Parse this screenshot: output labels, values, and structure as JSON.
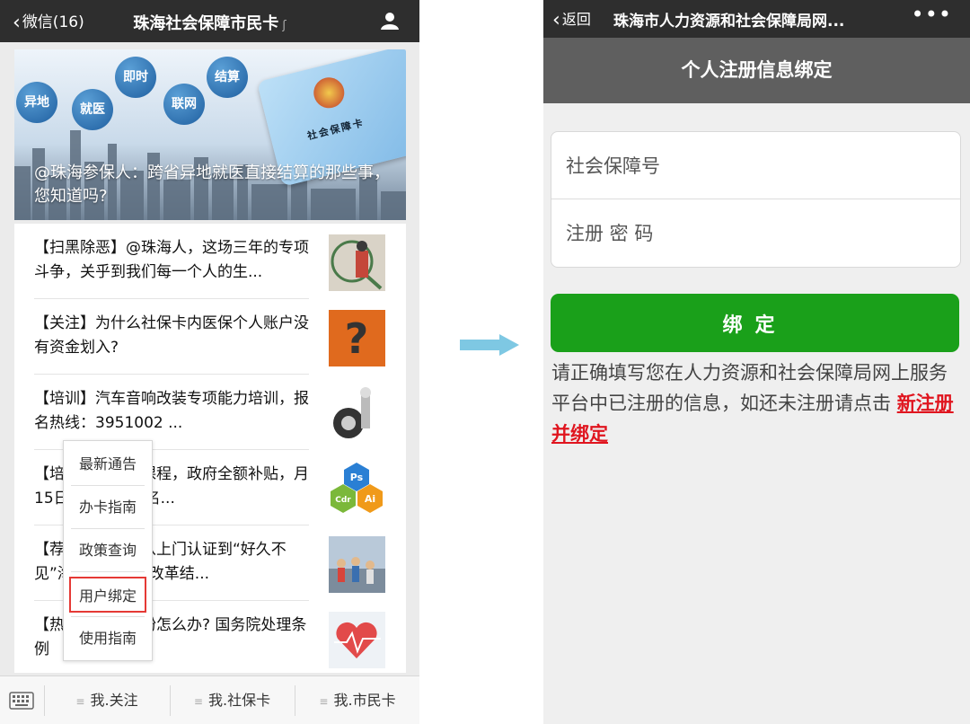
{
  "left": {
    "nav": {
      "back_label": "微信(16)",
      "title": "珠海社会保障市民卡"
    },
    "hero": {
      "bubbles": [
        "异地",
        "就医",
        "即时",
        "联网",
        "结算"
      ],
      "card_text": "社会保障卡",
      "caption": "@珠海参保人：跨省异地就医直接结算的那些事，您知道吗?"
    },
    "articles": [
      {
        "text": "【扫黑除恶】@珠海人，这场三年的专项斗争，关乎到我们每一个人的生..."
      },
      {
        "text": "【关注】为什么社保卡内医保个人账户没有资金划入?"
      },
      {
        "text": "【培训】汽车音响改装专项能力培训，报名热线：3951002 ..."
      },
      {
        "text": "【培训】门设计课程，政府全额补贴，月15日免费试听，名..."
      },
      {
        "text": "【荐读】报道｜从上门认证到“好久不见”海市十年认证改革结..."
      },
      {
        "text": "【热点】医疗纠纷怎么办? 国务院处理条例"
      }
    ],
    "popup_menu": [
      "最新通告",
      "办卡指南",
      "政策查询",
      "用户绑定",
      "使用指南"
    ],
    "tabs": [
      "我.关注",
      "我.社保卡",
      "我.市民卡"
    ]
  },
  "right": {
    "nav": {
      "back_label": "返回",
      "title": "珠海市人力资源和社会保障局网...",
      "more": "•••"
    },
    "page_title": "个人注册信息绑定",
    "form": {
      "ssn_placeholder": "社会保障号",
      "password_placeholder": "注册 密 码"
    },
    "bind_button": "绑定",
    "hint_text": "请正确填写您在人力资源和社会保障局网上服务平台中已注册的信息，如还未注册请点击",
    "hint_link": "新注册并绑定"
  },
  "colors": {
    "nav_bg": "#2e2e2e",
    "subbar_bg": "#5f5f5f",
    "bind_green": "#1aa01a",
    "link_red": "#e0151f",
    "arrow": "#7ec8e3"
  }
}
